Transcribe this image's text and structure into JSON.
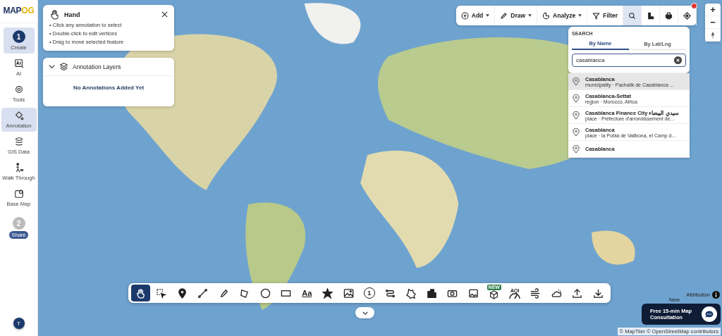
{
  "sidebar": {
    "logo": [
      "MAP",
      "OG"
    ],
    "steps": [
      {
        "number": "1",
        "label": "Create",
        "selected": true
      },
      {
        "number": "2",
        "label": "Share",
        "selected": false
      }
    ],
    "items": [
      {
        "kind": "ai",
        "label": "AI",
        "selected": false
      },
      {
        "kind": "tools",
        "label": "Tools",
        "selected": false
      },
      {
        "kind": "annotation",
        "label": "Annotation",
        "selected": true
      },
      {
        "kind": "gis",
        "label": "GIS Data",
        "selected": false
      },
      {
        "kind": "walk",
        "label": "Walk Through",
        "selected": false
      },
      {
        "kind": "basemap",
        "label": "Base Map",
        "selected": false
      }
    ],
    "user_avatar": "T"
  },
  "hand_panel": {
    "title": "Hand",
    "instructions": [
      "• Click any annotation to select",
      "• Double-click to edit vertices",
      "• Drag to move selected feature"
    ]
  },
  "annotation_layers": {
    "title": "Annotation Layers",
    "expanded": true,
    "empty_message": "No Annotations Added Yet"
  },
  "toolbar": {
    "buttons": [
      {
        "kind": "add",
        "label": "Add",
        "dropdown": true,
        "selected": false
      },
      {
        "kind": "draw",
        "label": "Draw",
        "dropdown": true,
        "selected": false
      },
      {
        "kind": "analyze",
        "label": "Analyze",
        "dropdown": true,
        "selected": false
      },
      {
        "kind": "filter",
        "label": "Filter",
        "dropdown": false,
        "selected": false
      },
      {
        "kind": "search",
        "dropdown": false,
        "selected": true
      },
      {
        "kind": "measure",
        "dropdown": false,
        "selected": false
      },
      {
        "kind": "print",
        "dropdown": false,
        "selected": false
      },
      {
        "kind": "locate",
        "dropdown": false,
        "selected": false
      }
    ]
  },
  "zoom_controls": {
    "zoom_in": "+",
    "zoom_out": "−"
  },
  "search": {
    "heading": "SEARCH",
    "tabs": [
      {
        "label": "By Name",
        "selected": true
      },
      {
        "label": "By Lat/Lng",
        "selected": false
      }
    ],
    "value": "casablanca",
    "results": [
      {
        "title": "Casablanca",
        "subtitle": "municipality · Pachalik de Casablanca ...",
        "selected": true
      },
      {
        "title": "Casablanca-Settat",
        "subtitle": "region · Morocco, Africa",
        "selected": false
      },
      {
        "title": "Casablanca Finance City سيدي البيضاء",
        "subtitle": "place · Préfecture d'arrondissement de...",
        "selected": false
      },
      {
        "title": "Casablanca",
        "subtitle": "place · la Pobla de Vallbona, el Camp d...",
        "selected": false
      },
      {
        "title": "Casablanca",
        "selected": false
      }
    ]
  },
  "drawing_tools": [
    {
      "kind": "hand",
      "selected": true
    },
    {
      "kind": "select",
      "selected": false
    },
    {
      "kind": "pin",
      "selected": false
    },
    {
      "kind": "line",
      "selected": false
    },
    {
      "kind": "pen",
      "selected": false
    },
    {
      "kind": "polygon",
      "selected": false
    },
    {
      "kind": "circle",
      "selected": false
    },
    {
      "kind": "rectangle",
      "selected": false
    },
    {
      "kind": "text",
      "text": "Aa",
      "selected": false
    },
    {
      "kind": "star",
      "selected": false
    },
    {
      "kind": "image",
      "selected": false
    },
    {
      "kind": "number",
      "text": "1",
      "selected": false
    },
    {
      "kind": "route",
      "selected": false
    },
    {
      "kind": "shape",
      "selected": false
    },
    {
      "kind": "building",
      "selected": false
    },
    {
      "kind": "camera",
      "selected": false
    },
    {
      "kind": "photo",
      "selected": false
    },
    {
      "kind": "cube",
      "badge": "NEW",
      "selected": false
    },
    {
      "kind": "aqi",
      "text": "AQI",
      "selected": false
    },
    {
      "kind": "wind",
      "selected": false
    },
    {
      "kind": "weather",
      "selected": false
    },
    {
      "kind": "upload",
      "selected": false
    },
    {
      "kind": "download",
      "selected": false
    }
  ],
  "attribution": {
    "label": "Attribution",
    "copyright": "© MapTiler © OpenStreetMap contributors"
  },
  "consultation": {
    "badge": "New",
    "label": "Free 15-min Map Consultation"
  }
}
